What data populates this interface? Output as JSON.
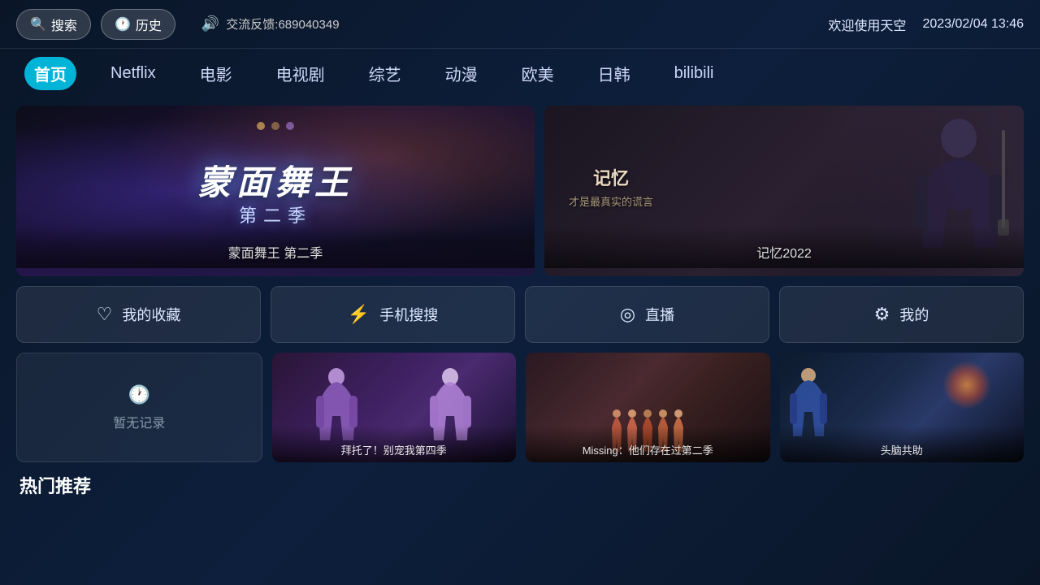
{
  "topbar": {
    "search_label": "搜索",
    "history_label": "历史",
    "feedback_label": "交流反馈:689040349",
    "welcome_text": "欢迎使用天空",
    "datetime": "2023/02/04 13:46"
  },
  "nav": {
    "items": [
      {
        "id": "home",
        "label": "首页",
        "active": true
      },
      {
        "id": "netflix",
        "label": "Netflix",
        "active": false
      },
      {
        "id": "movies",
        "label": "电影",
        "active": false
      },
      {
        "id": "tv",
        "label": "电视剧",
        "active": false
      },
      {
        "id": "variety",
        "label": "综艺",
        "active": false
      },
      {
        "id": "anime",
        "label": "动漫",
        "active": false
      },
      {
        "id": "western",
        "label": "欧美",
        "active": false
      },
      {
        "id": "korean",
        "label": "日韩",
        "active": false
      },
      {
        "id": "bilibili",
        "label": "bilibili",
        "active": false
      }
    ]
  },
  "hero": {
    "left": {
      "title_text": "蒙面舞王",
      "subtitle_text": "第二季",
      "caption": "蒙面舞王 第二季"
    },
    "right": {
      "title": "记忆",
      "subtitle": "才是最真实的谎言",
      "caption": "记忆2022"
    }
  },
  "quick_actions": [
    {
      "id": "favorites",
      "icon": "♡",
      "label": "我的收藏"
    },
    {
      "id": "mobile_search",
      "icon": "⚡",
      "label": "手机搜搜"
    },
    {
      "id": "live",
      "icon": "◎",
      "label": "直播"
    },
    {
      "id": "mine",
      "icon": "⚙",
      "label": "我的"
    }
  ],
  "recent": {
    "empty_label": "暂无记录",
    "items": [
      {
        "id": "card1",
        "title": "拜托了！别宠我第四季",
        "bg": "purple"
      },
      {
        "id": "card2",
        "title": "Missing：他们存在过第二季",
        "bg": "warm"
      },
      {
        "id": "card3",
        "title": "头脑共助",
        "bg": "blue"
      }
    ]
  },
  "section": {
    "title": "热门推荐"
  }
}
